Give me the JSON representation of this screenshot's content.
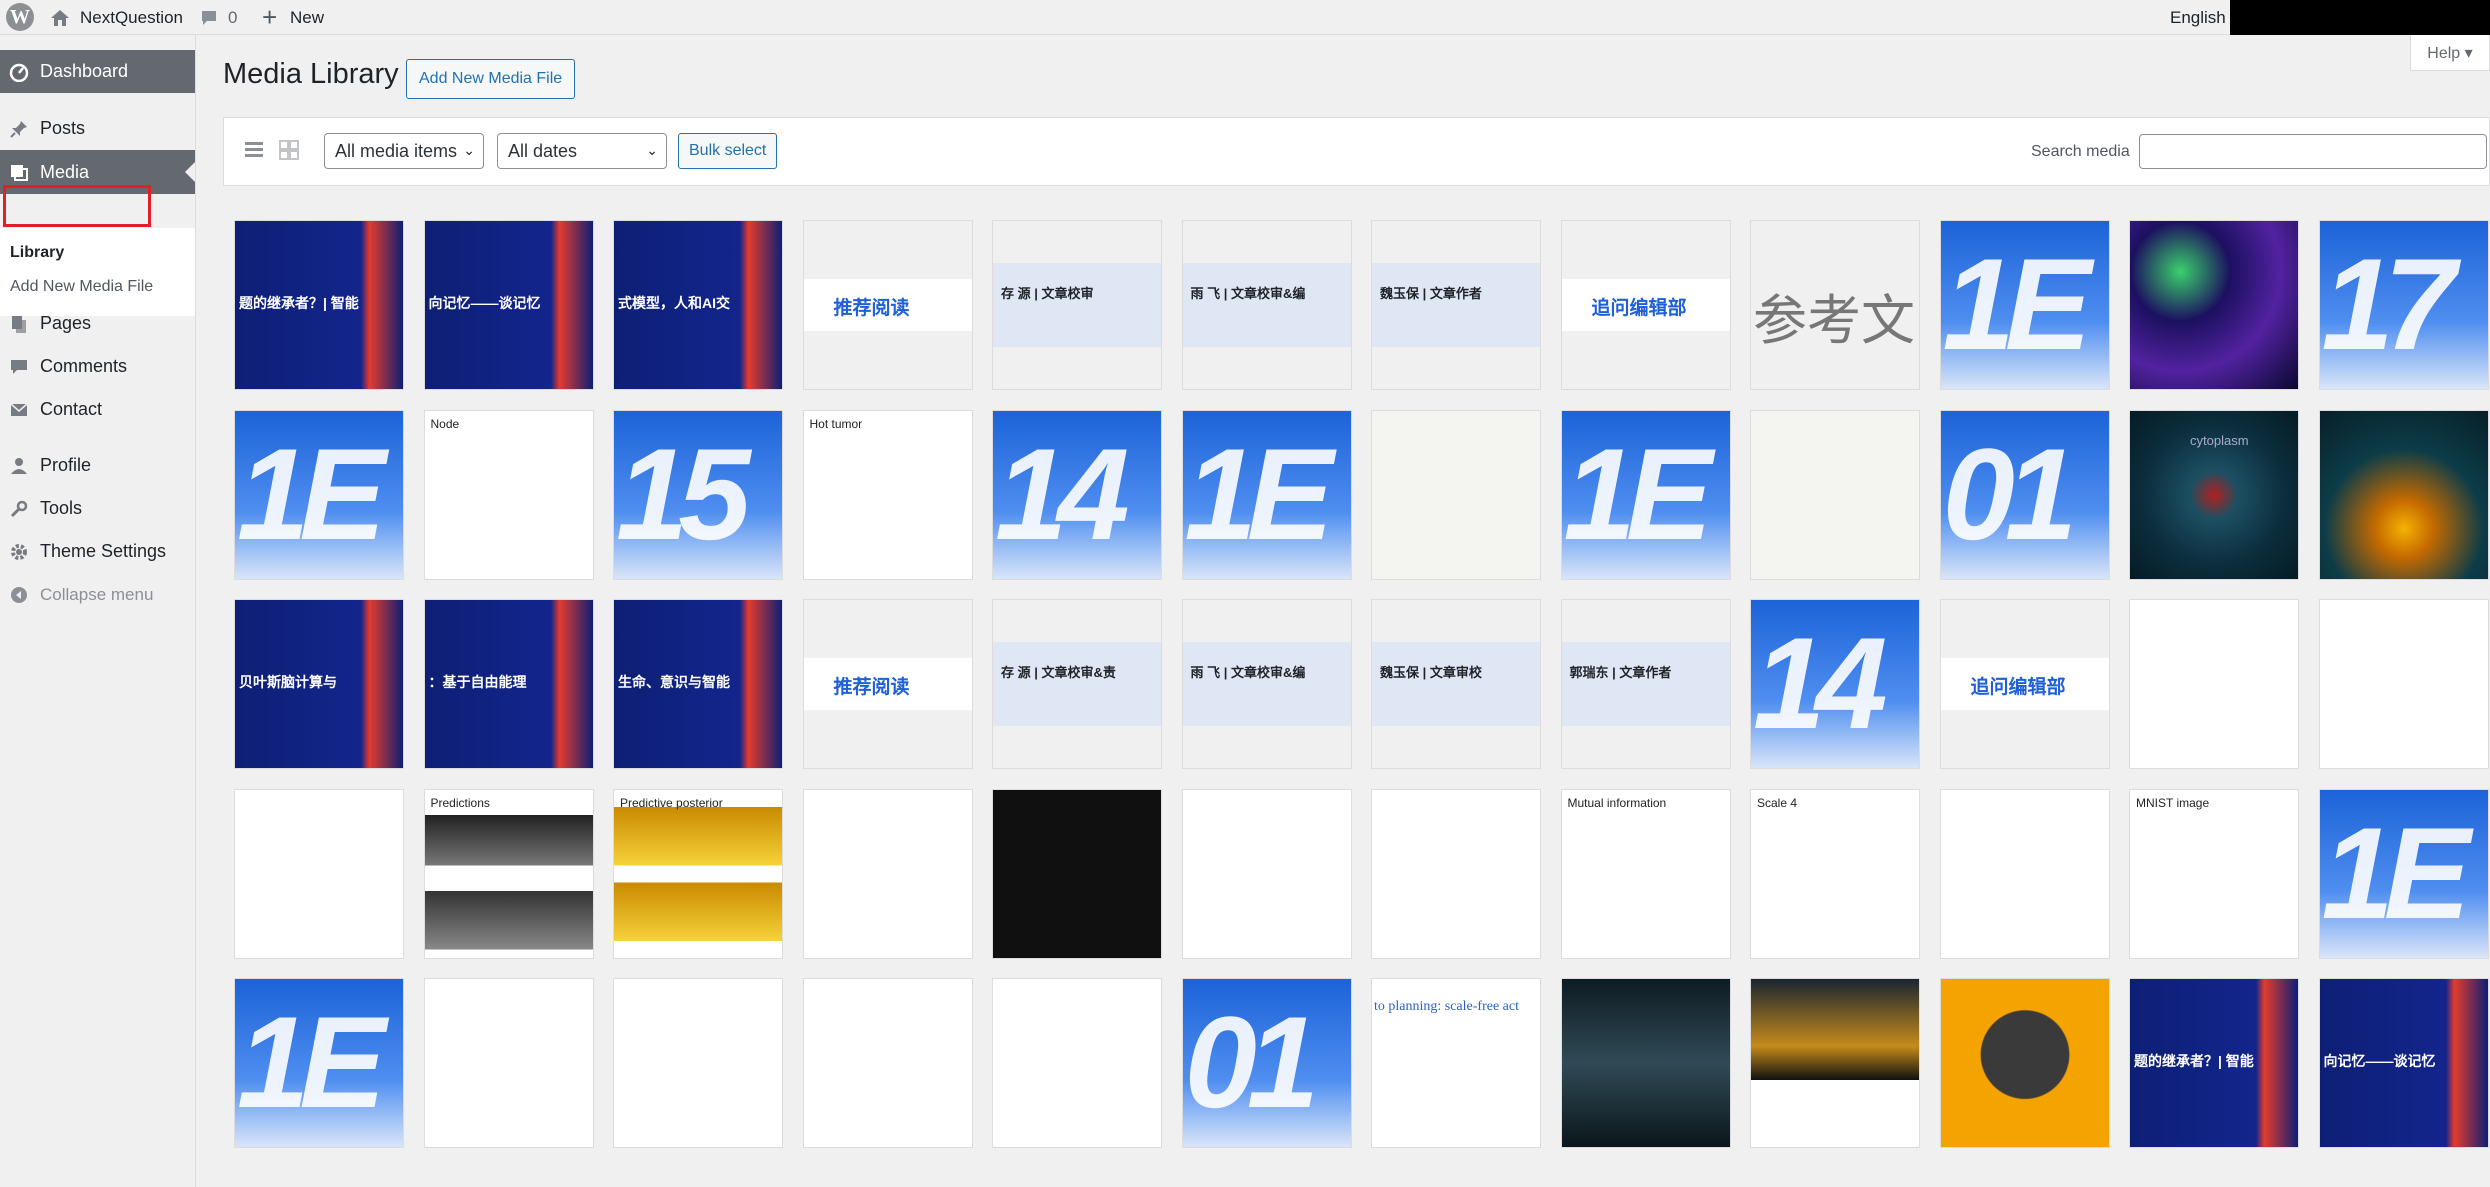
{
  "adminbar": {
    "site_name": "NextQuestion",
    "comment_count": "0",
    "new_label": "New",
    "language": "English"
  },
  "sidebar": {
    "dashboard": "Dashboard",
    "posts": "Posts",
    "media": "Media",
    "submenu_library": "Library",
    "submenu_add_new": "Add New Media File",
    "pages": "Pages",
    "comments": "Comments",
    "contact": "Contact",
    "profile": "Profile",
    "tools": "Tools",
    "theme_settings": "Theme Settings",
    "collapse": "Collapse menu"
  },
  "page": {
    "title": "Media Library",
    "add_new_button": "Add New Media File",
    "help": "Help ▾"
  },
  "toolbar": {
    "filter_type": "All media items",
    "filter_date": "All dates",
    "bulk_select": "Bulk select",
    "search_label": "Search media",
    "search_value": ""
  },
  "tiles": [
    {
      "kind": "navy",
      "text": "题的继承者？| 智能"
    },
    {
      "kind": "navy",
      "text": "向记忆——谈记忆"
    },
    {
      "kind": "navy",
      "text": "式模型，人和AI交"
    },
    {
      "kind": "banner",
      "text": "推荐阅读"
    },
    {
      "kind": "namecard",
      "text": "存 源 | 文章校审"
    },
    {
      "kind": "namecard",
      "text": "雨 飞 | 文章校审&编"
    },
    {
      "kind": "namecard",
      "text": "魏玉保 | 文章作者"
    },
    {
      "kind": "banner",
      "text": "追问编辑部"
    },
    {
      "kind": "plain",
      "text": "参考文"
    },
    {
      "kind": "bluebig",
      "text": "1E"
    },
    {
      "kind": "texture",
      "text": ""
    },
    {
      "kind": "bluebig",
      "text": "17"
    },
    {
      "kind": "bluebig",
      "text": "1E"
    },
    {
      "kind": "graph",
      "text": "Node"
    },
    {
      "kind": "bluebig",
      "text": "15"
    },
    {
      "kind": "tumor",
      "text": "Hot tumor"
    },
    {
      "kind": "bluebig",
      "text": "14"
    },
    {
      "kind": "bluebig",
      "text": "1E"
    },
    {
      "kind": "diagram",
      "text": ""
    },
    {
      "kind": "bluebig",
      "text": "1E"
    },
    {
      "kind": "diagram",
      "text": ""
    },
    {
      "kind": "bluebig",
      "text": "01"
    },
    {
      "kind": "cell",
      "text": "cytoplasm"
    },
    {
      "kind": "gold",
      "text": ""
    },
    {
      "kind": "navy",
      "text": "贝叶斯脑计算与"
    },
    {
      "kind": "navy",
      "text": "：基于自由能理"
    },
    {
      "kind": "navy",
      "text": "生命、意识与智能"
    },
    {
      "kind": "banner",
      "text": "推荐阅读"
    },
    {
      "kind": "namecard",
      "text": "存 源 | 文章校审&责"
    },
    {
      "kind": "namecard",
      "text": "雨 飞 | 文章校审&编"
    },
    {
      "kind": "namecard",
      "text": "魏玉保 | 文章审校"
    },
    {
      "kind": "namecard",
      "text": "郭瑞东 | 文章作者"
    },
    {
      "kind": "bluebig",
      "text": "14"
    },
    {
      "kind": "banner",
      "text": "追问编辑部"
    },
    {
      "kind": "flow",
      "text": ""
    },
    {
      "kind": "scatter",
      "text": ""
    },
    {
      "kind": "plot",
      "text": ""
    },
    {
      "kind": "spectro",
      "text": "Predictions"
    },
    {
      "kind": "yellow",
      "text": "Predictive posterior"
    },
    {
      "kind": "birds",
      "text": ""
    },
    {
      "kind": "birdsdark",
      "text": ""
    },
    {
      "kind": "birds",
      "text": ""
    },
    {
      "kind": "digits",
      "text": ""
    },
    {
      "kind": "mi",
      "text": "Mutual information"
    },
    {
      "kind": "digits",
      "text": "Scale 4"
    },
    {
      "kind": "plot",
      "text": ""
    },
    {
      "kind": "mnist",
      "text": "MNIST image"
    },
    {
      "kind": "bluebig",
      "text": "1E"
    },
    {
      "kind": "bluebig",
      "text": "1E"
    },
    {
      "kind": "tree",
      "text": ""
    },
    {
      "kind": "equations",
      "text": ""
    },
    {
      "kind": "equations",
      "text": ""
    },
    {
      "kind": "tree",
      "text": ""
    },
    {
      "kind": "bluebig",
      "text": "01"
    },
    {
      "kind": "paper",
      "text": "to planning: scale-free act"
    },
    {
      "kind": "robot",
      "text": ""
    },
    {
      "kind": "poster",
      "text": ""
    },
    {
      "kind": "monkey",
      "text": ""
    },
    {
      "kind": "navy",
      "text": "题的继承者？| 智能"
    },
    {
      "kind": "navy",
      "text": "向记忆——谈记忆"
    }
  ]
}
